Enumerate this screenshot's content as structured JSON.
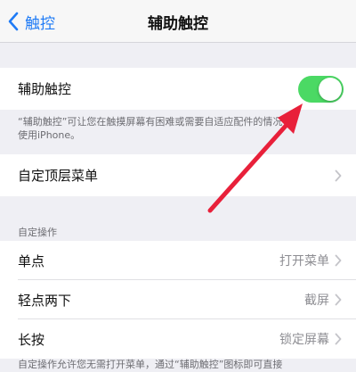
{
  "navbar": {
    "back_label": "触控",
    "title": "辅助触控"
  },
  "assistive_touch": {
    "label": "辅助触控",
    "toggle_state": "on",
    "footnote_line1": "“辅助触控”可让您在触摸屏幕有困难或需要自适应配件的情况下",
    "footnote_line2": "使用iPhone。"
  },
  "top_menu": {
    "label": "自定顶层菜单"
  },
  "custom_actions": {
    "header": "自定操作",
    "items": [
      {
        "label": "单点",
        "value": "打开菜单"
      },
      {
        "label": "轻点两下",
        "value": "截屏"
      },
      {
        "label": "长按",
        "value": "锁定屏幕"
      }
    ],
    "footnote": "自定操作允许您无需打开菜单，通过“辅助触控”图标即可直接"
  },
  "colors": {
    "toggle_on": "#4bd964",
    "accent": "#1f7bf6",
    "annotation_arrow": "#e8203a"
  }
}
